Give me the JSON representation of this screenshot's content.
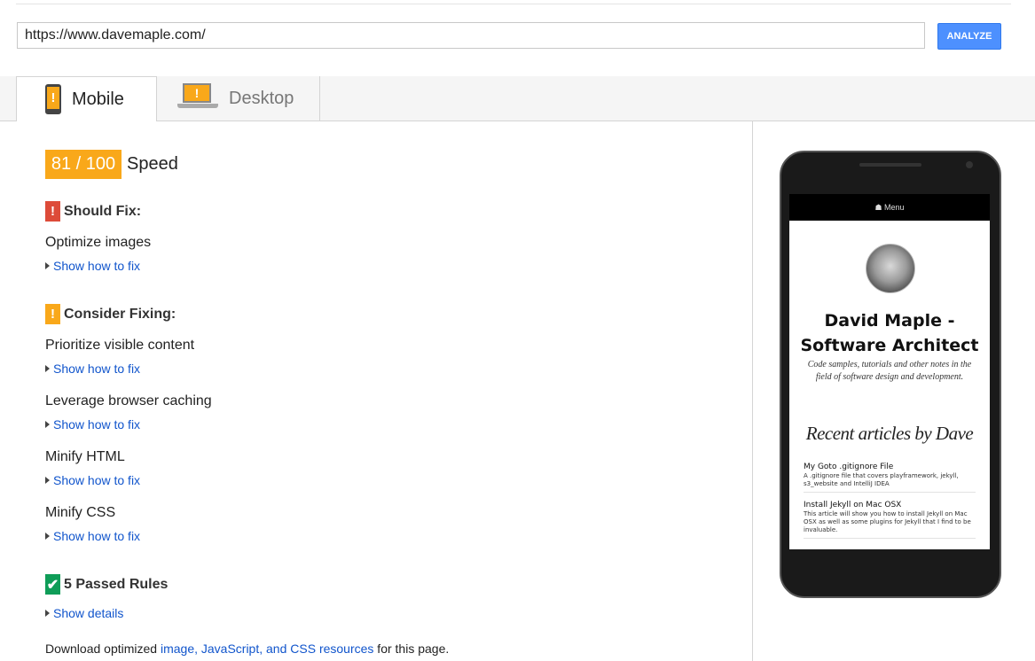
{
  "url_bar": {
    "value": "https://www.davemaple.com/",
    "analyze_label": "ANALYZE"
  },
  "tabs": [
    {
      "label": "Mobile",
      "icon": "mobile-phone-icon",
      "active": true
    },
    {
      "label": "Desktop",
      "icon": "desktop-monitor-icon",
      "active": false
    }
  ],
  "score": {
    "value": "81 / 100",
    "label": "Speed",
    "color": "#f9a81a"
  },
  "should_fix": {
    "badge": "!",
    "heading": "Should Fix:",
    "rules": [
      {
        "name": "Optimize images",
        "link": "Show how to fix"
      }
    ]
  },
  "consider_fixing": {
    "badge": "!",
    "heading": "Consider Fixing:",
    "rules": [
      {
        "name": "Prioritize visible content",
        "link": "Show how to fix"
      },
      {
        "name": "Leverage browser caching",
        "link": "Show how to fix"
      },
      {
        "name": "Minify HTML",
        "link": "Show how to fix"
      },
      {
        "name": "Minify CSS",
        "link": "Show how to fix"
      }
    ]
  },
  "passed": {
    "badge": "✔",
    "heading": "5 Passed Rules",
    "link": "Show details"
  },
  "footer": {
    "prefix": "Download optimized ",
    "link": "image, JavaScript, and CSS resources",
    "suffix": " for this page."
  },
  "preview": {
    "menu": "☗ Menu",
    "title_line1": "David Maple -",
    "title_line2": "Software Architect",
    "description": "Code samples, tutorials and other notes in the field of software design and development.",
    "recent_heading": "Recent articles by Dave",
    "articles": [
      {
        "title": "My Goto .gitignore File",
        "desc": "A .gitignore file that covers playframework, jekyll, s3_website and IntelliJ IDEA"
      },
      {
        "title": "Install Jekyll on Mac OSX",
        "desc": "This article will show you how to install Jekyll on Mac OSX as well as some plugins for Jekyll that I find to be invaluable."
      }
    ]
  },
  "colors": {
    "red": "#dd4b39",
    "orange": "#f9a81a",
    "green": "#0f9d58",
    "link": "#1155cc",
    "button": "#4d90fe"
  }
}
